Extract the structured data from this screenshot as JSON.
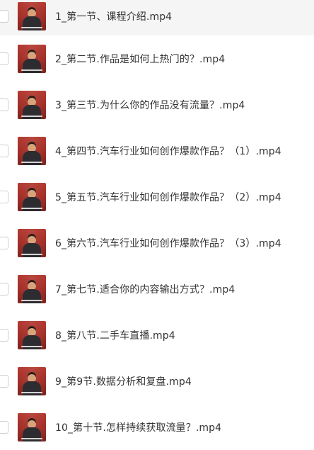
{
  "files": [
    {
      "name": "1_第一节、课程介绍.mp4",
      "thumb": "video-thumbnail"
    },
    {
      "name": "2_第二节.作品是如何上热门的？.mp4",
      "thumb": "video-thumbnail"
    },
    {
      "name": "3_第三节.为什么你的作品没有流量？.mp4",
      "thumb": "video-thumbnail"
    },
    {
      "name": "4_第四节.汽车行业如何创作爆款作品？（1）.mp4",
      "thumb": "video-thumbnail"
    },
    {
      "name": "5_第五节.汽车行业如何创作爆款作品？（2）.mp4",
      "thumb": "video-thumbnail"
    },
    {
      "name": "6_第六节.汽车行业如何创作爆款作品？（3）.mp4",
      "thumb": "video-thumbnail"
    },
    {
      "name": "7_第七节.适合你的内容输出方式？.mp4",
      "thumb": "video-thumbnail"
    },
    {
      "name": "8_第八节.二手车直播.mp4",
      "thumb": "video-thumbnail"
    },
    {
      "name": "9_第9节.数据分析和复盘.mp4",
      "thumb": "video-thumbnail"
    },
    {
      "name": "10_第十节.怎样持续获取流量？.mp4",
      "thumb": "video-thumbnail"
    }
  ],
  "colors": {
    "row_highlight": "#f5f5f5",
    "text": "#333333",
    "thumb_background": "#a8332a"
  }
}
